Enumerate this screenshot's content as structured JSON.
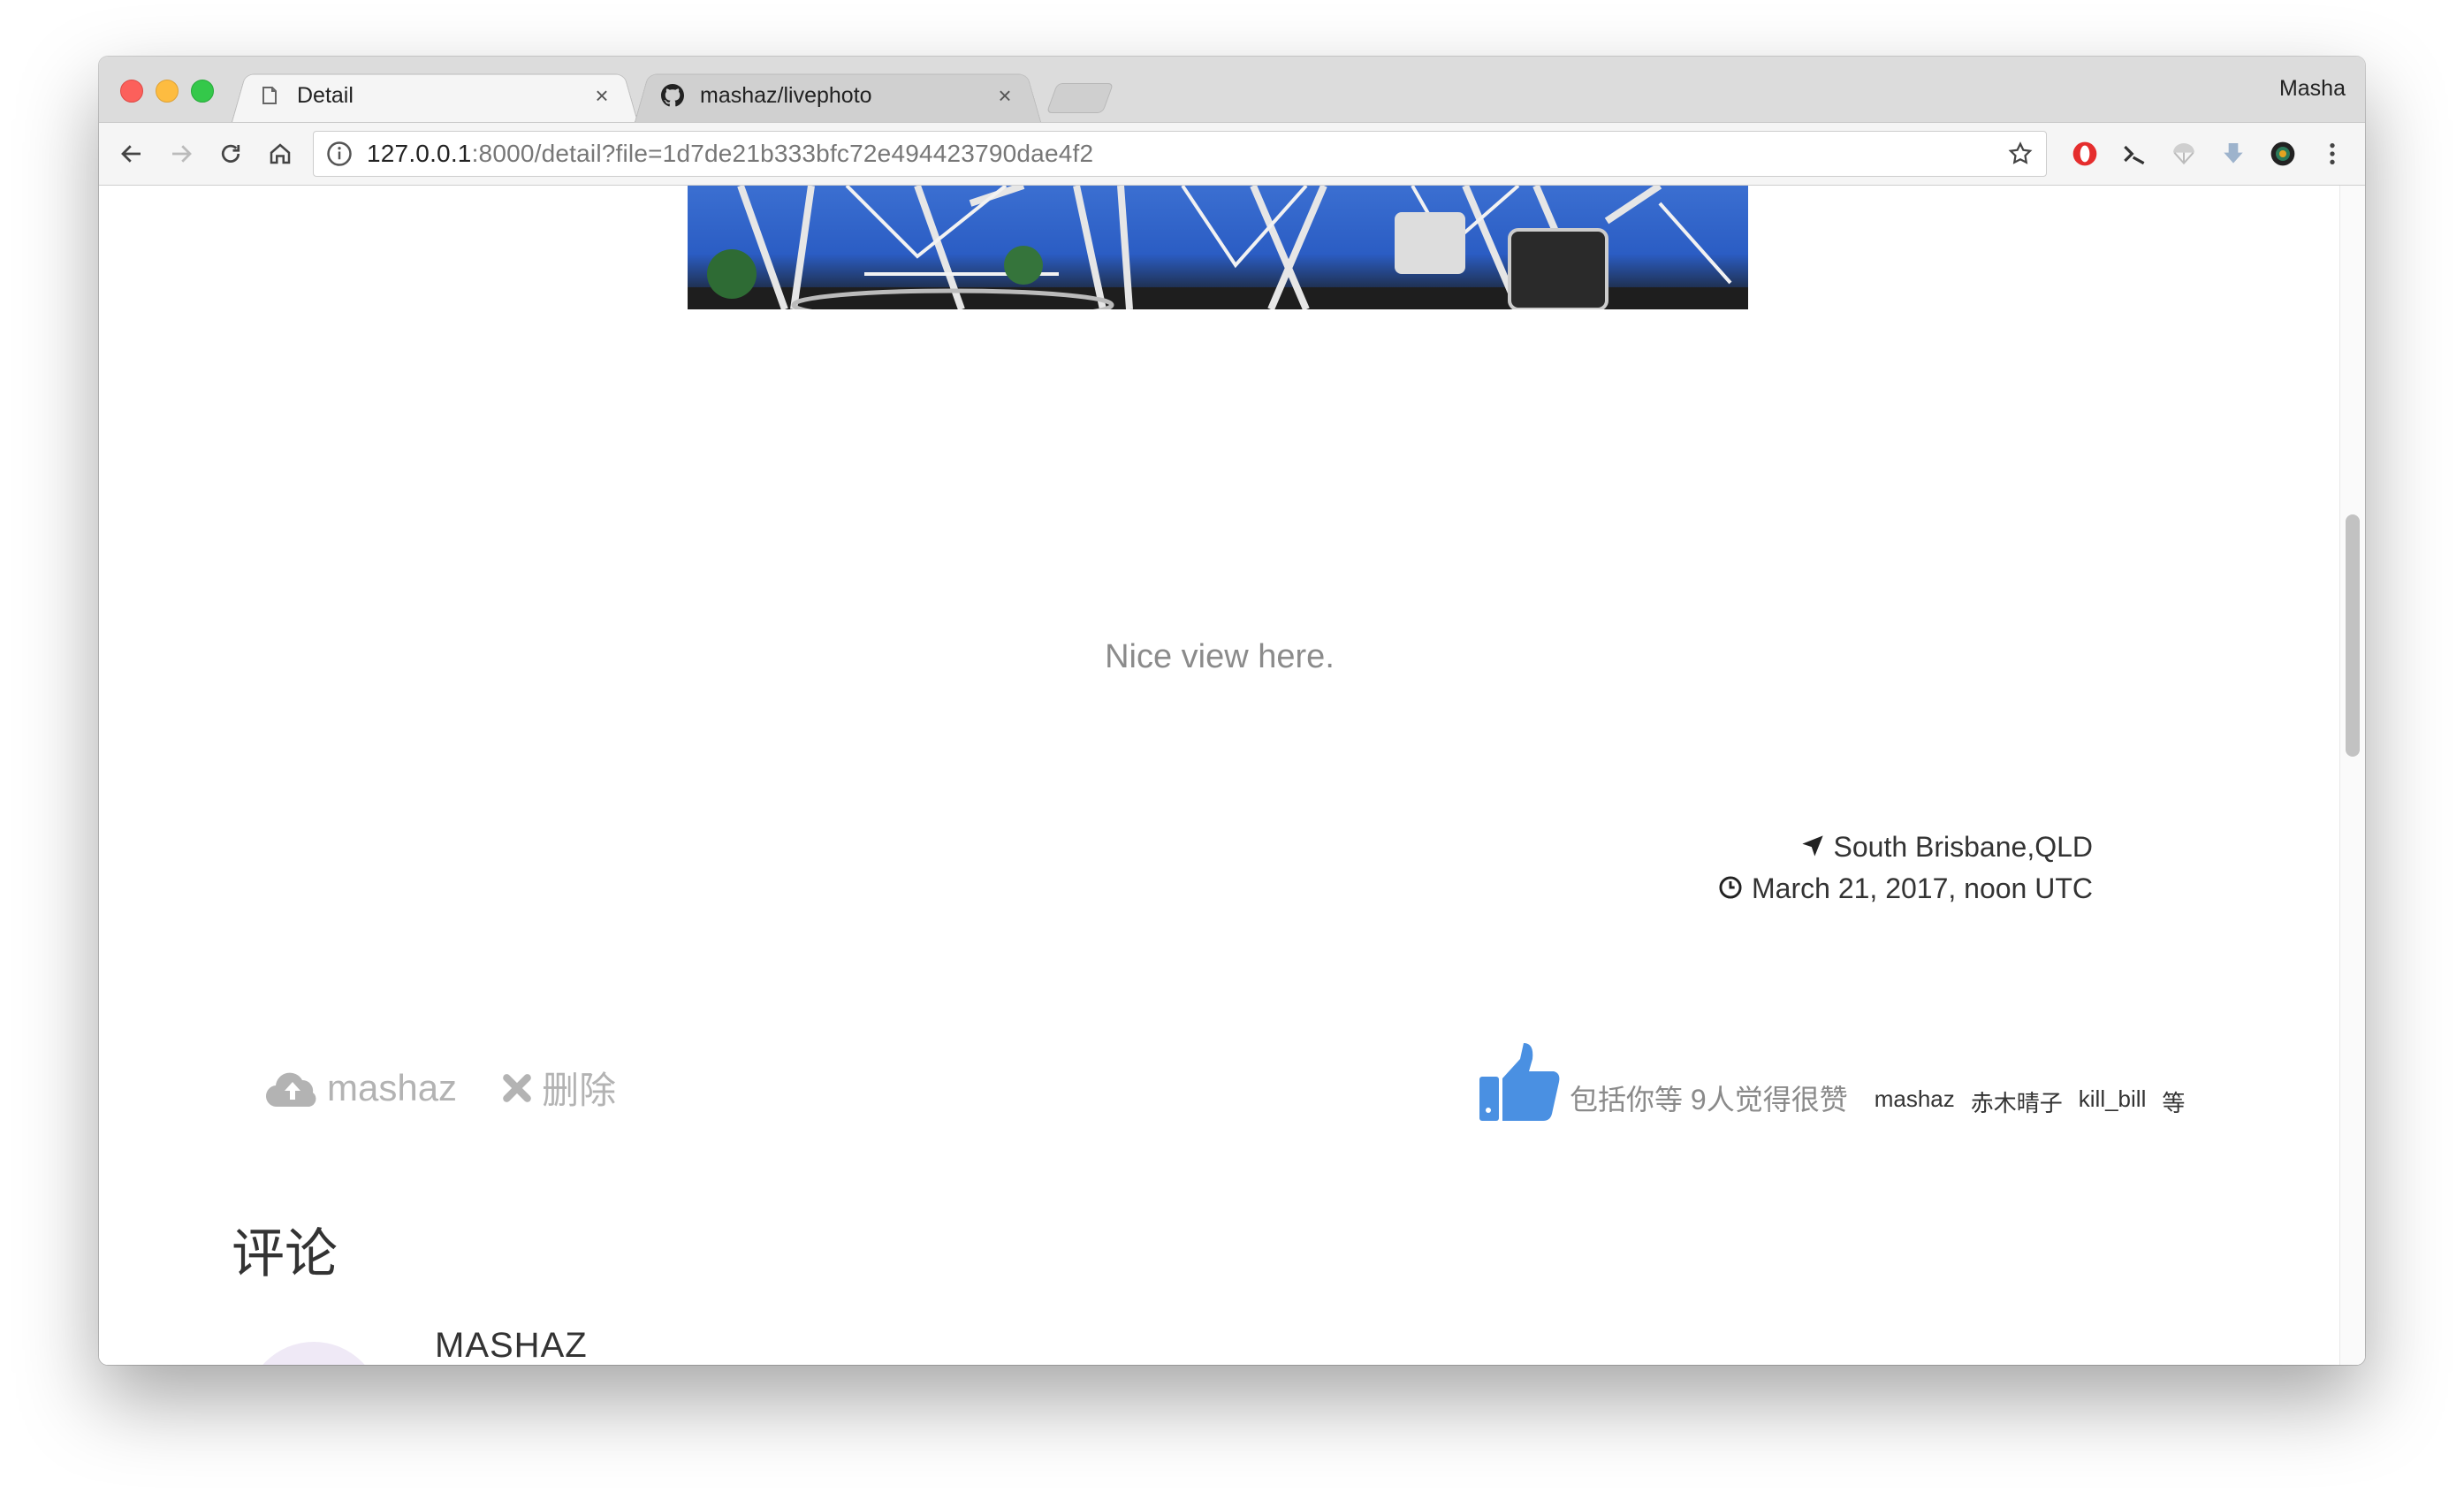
{
  "browser": {
    "tabs": [
      {
        "label": "Detail",
        "icon": "page-icon",
        "active": true
      },
      {
        "label": "mashaz/livephoto",
        "icon": "github-icon",
        "active": false
      }
    ],
    "profile": "Masha",
    "url": {
      "host": "127.0.0.1",
      "rest": ":8000/detail?file=1d7de21b333bfc72e494423790dae4f2"
    },
    "extensions": [
      "opera-icon",
      "wrench-icon",
      "parachute-icon",
      "download-icon",
      "camera-lens-icon"
    ]
  },
  "page": {
    "caption": "Nice view here.",
    "location": "South Brisbane,QLD",
    "date": "March 21, 2017, noon UTC",
    "actions": {
      "upload_user": "mashaz",
      "delete_label": "删除"
    },
    "likes": {
      "summary": "包括你等 9人觉得很赞",
      "users": [
        "mashaz",
        "赤木晴子",
        "kill_bill",
        "等"
      ]
    },
    "comments": {
      "title": "评论",
      "items": [
        {
          "user": "MASHAZ"
        }
      ]
    }
  },
  "colors": {
    "like_blue": "#4a90e2",
    "muted_gray": "#b3b3b3"
  }
}
